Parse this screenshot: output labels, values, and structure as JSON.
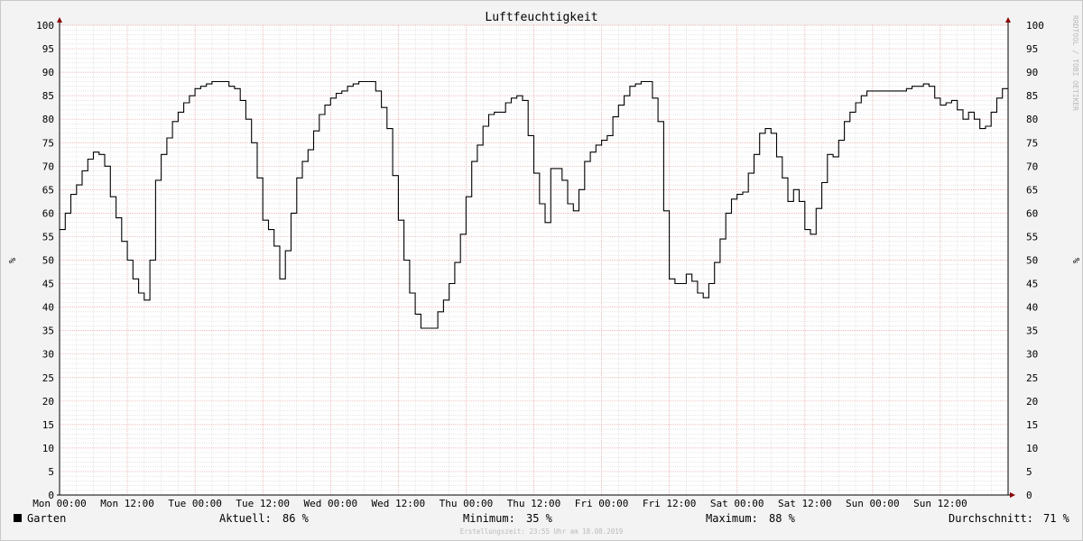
{
  "chart_data": {
    "type": "line",
    "title": "Luftfeuchtigkeit",
    "ylabel": "%",
    "ylabel_right": "%",
    "ylim": [
      0,
      100
    ],
    "y_ticks": [
      0,
      5,
      10,
      15,
      20,
      25,
      30,
      35,
      40,
      45,
      50,
      55,
      60,
      65,
      70,
      75,
      80,
      85,
      90,
      95,
      100
    ],
    "xlim": [
      0,
      168
    ],
    "x_ticks": [
      {
        "h": 0,
        "label": "Mon 00:00"
      },
      {
        "h": 12,
        "label": "Mon 12:00"
      },
      {
        "h": 24,
        "label": "Tue 00:00"
      },
      {
        "h": 36,
        "label": "Tue 12:00"
      },
      {
        "h": 48,
        "label": "Wed 00:00"
      },
      {
        "h": 60,
        "label": "Wed 12:00"
      },
      {
        "h": 72,
        "label": "Thu 00:00"
      },
      {
        "h": 84,
        "label": "Thu 12:00"
      },
      {
        "h": 96,
        "label": "Fri 00:00"
      },
      {
        "h": 108,
        "label": "Fri 12:00"
      },
      {
        "h": 120,
        "label": "Sat 00:00"
      },
      {
        "h": 132,
        "label": "Sat 12:00"
      },
      {
        "h": 144,
        "label": "Sun 00:00"
      },
      {
        "h": 156,
        "label": "Sun 12:00"
      }
    ],
    "grid": true,
    "line_color": "#000000",
    "series": [
      {
        "name": "Garten",
        "step": true,
        "points": [
          [
            0,
            56.5
          ],
          [
            1,
            60
          ],
          [
            2,
            64
          ],
          [
            3,
            66
          ],
          [
            4,
            69
          ],
          [
            5,
            71.5
          ],
          [
            6,
            73
          ],
          [
            7,
            72.5
          ],
          [
            8,
            70
          ],
          [
            9,
            63.5
          ],
          [
            10,
            59
          ],
          [
            11,
            54
          ],
          [
            12,
            50
          ],
          [
            13,
            46
          ],
          [
            14,
            43
          ],
          [
            15,
            41.5
          ],
          [
            16,
            50
          ],
          [
            17,
            67
          ],
          [
            18,
            72.5
          ],
          [
            19,
            76
          ],
          [
            20,
            79.5
          ],
          [
            21,
            81.5
          ],
          [
            22,
            83.5
          ],
          [
            23,
            85
          ],
          [
            24,
            86.5
          ],
          [
            25,
            87
          ],
          [
            26,
            87.5
          ],
          [
            27,
            88
          ],
          [
            28,
            88
          ],
          [
            29,
            88
          ],
          [
            30,
            87
          ],
          [
            31,
            86.5
          ],
          [
            32,
            84
          ],
          [
            33,
            80
          ],
          [
            34,
            75
          ],
          [
            35,
            67.5
          ],
          [
            36,
            58.5
          ],
          [
            37,
            56.5
          ],
          [
            38,
            53
          ],
          [
            39,
            46
          ],
          [
            40,
            52
          ],
          [
            41,
            60
          ],
          [
            42,
            67.5
          ],
          [
            43,
            71
          ],
          [
            44,
            73.5
          ],
          [
            45,
            77.5
          ],
          [
            46,
            81
          ],
          [
            47,
            83
          ],
          [
            48,
            84.5
          ],
          [
            49,
            85.5
          ],
          [
            50,
            86
          ],
          [
            51,
            87
          ],
          [
            52,
            87.5
          ],
          [
            53,
            88
          ],
          [
            54,
            88
          ],
          [
            55,
            88
          ],
          [
            56,
            86
          ],
          [
            57,
            82.5
          ],
          [
            58,
            78
          ],
          [
            59,
            68
          ],
          [
            60,
            58.5
          ],
          [
            61,
            50
          ],
          [
            62,
            43
          ],
          [
            63,
            38.5
          ],
          [
            64,
            35.5
          ],
          [
            65,
            35.5
          ],
          [
            66,
            35.5
          ],
          [
            67,
            39
          ],
          [
            68,
            41.5
          ],
          [
            69,
            45
          ],
          [
            70,
            49.5
          ],
          [
            71,
            55.5
          ],
          [
            72,
            63.5
          ],
          [
            73,
            71
          ],
          [
            74,
            74.5
          ],
          [
            75,
            78.5
          ],
          [
            76,
            81
          ],
          [
            77,
            81.5
          ],
          [
            78,
            81.5
          ],
          [
            79,
            83.5
          ],
          [
            80,
            84.5
          ],
          [
            81,
            85
          ],
          [
            82,
            84
          ],
          [
            83,
            76.5
          ],
          [
            84,
            68.5
          ],
          [
            85,
            62
          ],
          [
            86,
            58
          ],
          [
            87,
            69.5
          ],
          [
            88,
            69.5
          ],
          [
            89,
            67
          ],
          [
            90,
            62
          ],
          [
            91,
            60.5
          ],
          [
            92,
            65
          ],
          [
            93,
            71
          ],
          [
            94,
            73
          ],
          [
            95,
            74.5
          ],
          [
            96,
            75.5
          ],
          [
            97,
            76.5
          ],
          [
            98,
            80.5
          ],
          [
            99,
            83
          ],
          [
            100,
            85
          ],
          [
            101,
            87
          ],
          [
            102,
            87.5
          ],
          [
            103,
            88
          ],
          [
            104,
            88
          ],
          [
            105,
            84.5
          ],
          [
            106,
            79.5
          ],
          [
            107,
            60.5
          ],
          [
            108,
            46
          ],
          [
            109,
            45
          ],
          [
            110,
            45
          ],
          [
            111,
            47
          ],
          [
            112,
            45.5
          ],
          [
            113,
            43
          ],
          [
            114,
            42
          ],
          [
            115,
            45
          ],
          [
            116,
            49.5
          ],
          [
            117,
            54.5
          ],
          [
            118,
            60
          ],
          [
            119,
            63
          ],
          [
            120,
            64
          ],
          [
            121,
            64.5
          ],
          [
            122,
            68.5
          ],
          [
            123,
            72.5
          ],
          [
            124,
            77
          ],
          [
            125,
            78
          ],
          [
            126,
            77
          ],
          [
            127,
            72
          ],
          [
            128,
            67.5
          ],
          [
            129,
            62.5
          ],
          [
            130,
            65
          ],
          [
            131,
            62.5
          ],
          [
            132,
            56.5
          ],
          [
            133,
            55.5
          ],
          [
            134,
            61
          ],
          [
            135,
            66.5
          ],
          [
            136,
            72.5
          ],
          [
            137,
            72
          ],
          [
            138,
            75.5
          ],
          [
            139,
            79.5
          ],
          [
            140,
            81.5
          ],
          [
            141,
            83.5
          ],
          [
            142,
            85
          ],
          [
            143,
            86
          ],
          [
            144,
            86
          ],
          [
            145,
            86
          ],
          [
            146,
            86
          ],
          [
            147,
            86
          ],
          [
            148,
            86
          ],
          [
            149,
            86
          ],
          [
            150,
            86.5
          ],
          [
            151,
            87
          ],
          [
            152,
            87
          ],
          [
            153,
            87.5
          ],
          [
            154,
            87
          ],
          [
            155,
            84.5
          ],
          [
            156,
            83
          ],
          [
            157,
            83.5
          ],
          [
            158,
            84
          ],
          [
            159,
            82
          ],
          [
            160,
            80
          ],
          [
            161,
            81.5
          ],
          [
            162,
            80
          ],
          [
            163,
            78
          ],
          [
            164,
            78.5
          ],
          [
            165,
            81.5
          ],
          [
            166,
            84.5
          ],
          [
            167,
            86.5
          ],
          [
            168,
            86.5
          ]
        ]
      }
    ]
  },
  "legend": {
    "swatch_color": "#000000",
    "series_name": "Garten",
    "stats": [
      {
        "label": "Aktuell:",
        "value": "86 %"
      },
      {
        "label": "Minimum:",
        "value": "35 %"
      },
      {
        "label": "Maximum:",
        "value": "88 %"
      },
      {
        "label": "Durchschnitt:",
        "value": "71 %"
      }
    ]
  },
  "watermark": "RRDTOOL / TOBI OETIKER",
  "footer": "Erstellungszeit: 23:55 Uhr am 18.08.2019",
  "colors": {
    "background": "#f3f3f3",
    "plot_background": "#ffffff",
    "major_grid": "#e8a0a0",
    "minor_grid": "#d6d6d6",
    "axis_arrow": "#8b0000",
    "text": "#000000",
    "watermark": "#bbbbbb"
  }
}
